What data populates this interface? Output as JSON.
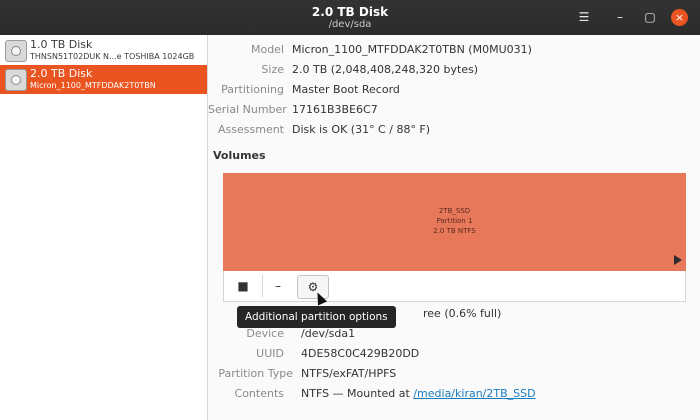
{
  "window": {
    "title": "2.0 TB Disk",
    "subtitle": "/dev/sda",
    "menu_icon": "☰",
    "minimize_icon": "–",
    "maximize_icon": "▢",
    "close_icon": "×"
  },
  "sidebar": {
    "items": [
      {
        "name": "1.0 TB Disk",
        "model": "THNSN51T02DUK N...e TOSHIBA 1024GB",
        "selected": false
      },
      {
        "name": "2.0 TB Disk",
        "model": "Micron_1100_MTFDDAK2T0TBN",
        "selected": true
      }
    ]
  },
  "details": {
    "model_label": "Model",
    "model": "Micron_1100_MTFDDAK2T0TBN (M0MU031)",
    "size_label": "Size",
    "size": "2.0 TB (2,048,408,248,320 bytes)",
    "partitioning_label": "Partitioning",
    "partitioning": "Master Boot Record",
    "serial_label": "Serial Number",
    "serial": "17161B3BE6C7",
    "assessment_label": "Assessment",
    "assessment": "Disk is OK (31° C / 88° F)"
  },
  "volumes": {
    "title": "Volumes",
    "partition": {
      "name": "2TB_SSD",
      "index": "Partition 1",
      "fs": "2.0 TB NTFS"
    },
    "toolbar": {
      "stop": "■",
      "remove": "–",
      "gear": "⚙"
    },
    "tooltip": "Additional partition options",
    "free_text": "ree (0.6% full)",
    "device_label": "Device",
    "device": "/dev/sda1",
    "uuid_label": "UUID",
    "uuid": "4DE58C0C429B20DD",
    "ptype_label": "Partition Type",
    "ptype": "NTFS/exFAT/HPFS",
    "contents_label": "Contents",
    "contents_prefix": "NTFS — Mounted at ",
    "mount_link": "/media/kiran/2TB_SSD"
  },
  "colors": {
    "accent": "#e95420",
    "volume": "#e8785a",
    "titlebar": "#2d2d2d"
  }
}
